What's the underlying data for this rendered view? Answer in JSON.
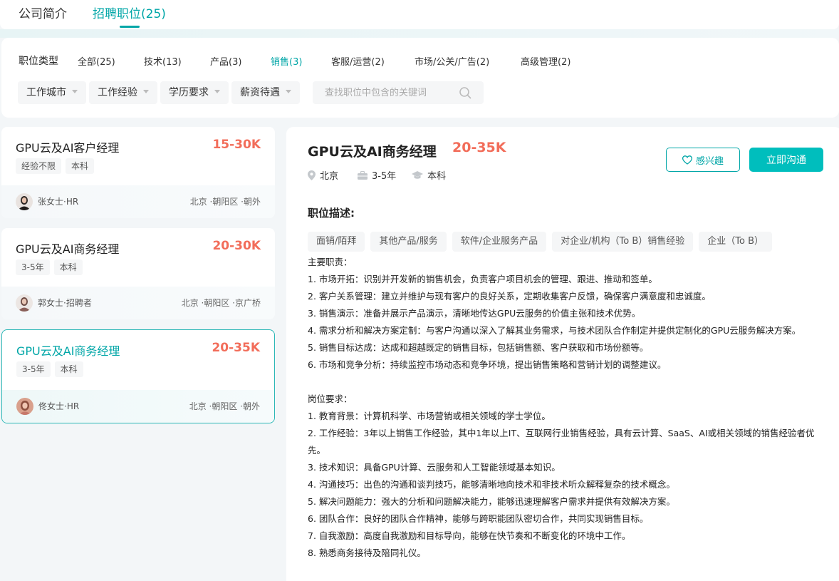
{
  "tabs": {
    "company_intro": "公司简介",
    "jobs": "招聘职位(25)"
  },
  "filter": {
    "type_label": "职位类型",
    "categories": [
      "全部(25)",
      "技术(13)",
      "产品(3)",
      "销售(3)",
      "客服/运营(2)",
      "市场/公关/广告(2)",
      "高级管理(2)"
    ],
    "active_category": "销售(3)",
    "dropdowns": [
      "工作城市",
      "工作经验",
      "学历要求",
      "薪资待遇"
    ],
    "search_placeholder": "查找职位中包含的关键词"
  },
  "job_cards": [
    {
      "title": "GPU云及AI客户经理",
      "salary": "15-30K",
      "tags": [
        "经验不限",
        "本科"
      ],
      "hr": "张女士·HR",
      "location": "北京 ·朝阳区 ·朝外"
    },
    {
      "title": "GPU云及AI商务经理",
      "salary": "20-30K",
      "tags": [
        "3-5年",
        "本科"
      ],
      "hr": "郭女士·招聘者",
      "location": "北京 ·朝阳区 ·京广桥"
    },
    {
      "title": "GPU云及AI商务经理",
      "salary": "20-35K",
      "tags": [
        "3-5年",
        "本科"
      ],
      "hr": "佟女士·HR",
      "location": "北京 ·朝阳区 ·朝外"
    }
  ],
  "detail": {
    "title": "GPU云及AI商务经理",
    "salary": "20-35K",
    "city": "北京",
    "experience": "3-5年",
    "education": "本科",
    "interest_label": "感兴趣",
    "chat_label": "立即沟通",
    "section_title": "职位描述:",
    "keywords": [
      "面销/陌拜",
      "其他产品/服务",
      "软件/企业服务产品",
      "对企业/机构（To B）销售经验",
      "企业（To B）"
    ],
    "lines": [
      "主要职责：",
      "1. 市场开拓：识别并开发新的销售机会，负责客户项目机会的管理、跟进、推动和签单。",
      "2. 客户关系管理：建立并维护与现有客户的良好关系，定期收集客户反馈，确保客户满意度和忠诚度。",
      "3. 销售演示：准备并展示产品演示，清晰地传达GPU云服务的价值主张和技术优势。",
      "4. 需求分析和解决方案定制：与客户沟通以深入了解其业务需求，与技术团队合作制定并提供定制化的GPU云服务解决方案。",
      "5. 销售目标达成：达成和超越既定的销售目标，包括销售额、客户获取和市场份额等。",
      "6. 市场和竞争分析：持续监控市场动态和竞争环境，提出销售策略和营销计划的调整建议。",
      "岗位要求：",
      "1. 教育背景：计算机科学、市场营销或相关领域的学士学位。",
      "2. 工作经验：3年以上销售工作经验，其中1年以上IT、互联网行业销售经验，具有云计算、SaaS、AI或相关领域的销售经验者优先。",
      "3. 技术知识：具备GPU计算、云服务和人工智能领域基本知识。",
      "4. 沟通技巧：出色的沟通和谈判技巧，能够清晰地向技术和非技术听众解释复杂的技术概念。",
      "5. 解决问题能力：强大的分析和问题解决能力，能够迅速理解客户需求并提供有效解决方案。",
      "6. 团队合作：良好的团队合作精神，能够与跨职能团队密切合作，共同实现销售目标。",
      "7. 自我激励：高度自我激励和目标导向，能够在快节奏和不断变化的环境中工作。",
      "8. 熟悉商务接待及陪同礼仪。"
    ]
  },
  "colors": {
    "accent": "#00a6a7",
    "salary": "#f26d5a",
    "button": "#00bebd"
  }
}
